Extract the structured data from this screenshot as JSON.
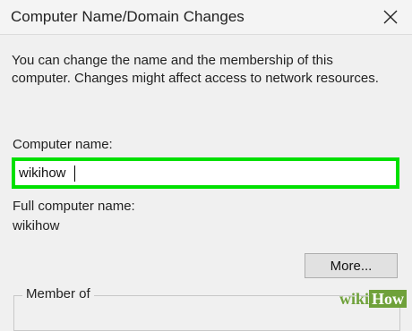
{
  "window": {
    "title": "Computer Name/Domain Changes"
  },
  "description": {
    "line1": "You can change the name and the membership of this",
    "line2": "computer. Changes might affect access to network resources."
  },
  "computer_name": {
    "label": "Computer name:",
    "value": "wikihow"
  },
  "full_name": {
    "label": "Full computer name:",
    "value": "wikihow"
  },
  "buttons": {
    "more": "More..."
  },
  "member_of": {
    "label": "Member of"
  },
  "watermark": {
    "part1": "wiki",
    "part2": "How"
  },
  "colors": {
    "highlight": "#00e000",
    "background": "#f0f0f0",
    "watermark": "#6fa13a"
  },
  "icons": {
    "close": "close-icon"
  }
}
